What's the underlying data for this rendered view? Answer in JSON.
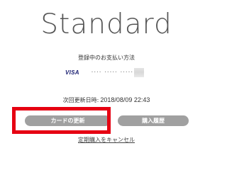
{
  "plan": {
    "title": "Standard"
  },
  "payment": {
    "section_label": "登録中のお支払い方法",
    "card_brand": "VISA",
    "masked_number": "···· ····· ·····"
  },
  "renewal": {
    "label": "次回更新日時:",
    "datetime": "2018/08/09 22:43"
  },
  "actions": {
    "update_card_label": "カードの更新",
    "purchase_history_label": "購入履歴",
    "cancel_subscription_label": "定期購入をキャンセル"
  },
  "colors": {
    "highlight": "#e60012",
    "button_bg": "#a0a0a0",
    "visa_blue": "#1a1f71"
  }
}
